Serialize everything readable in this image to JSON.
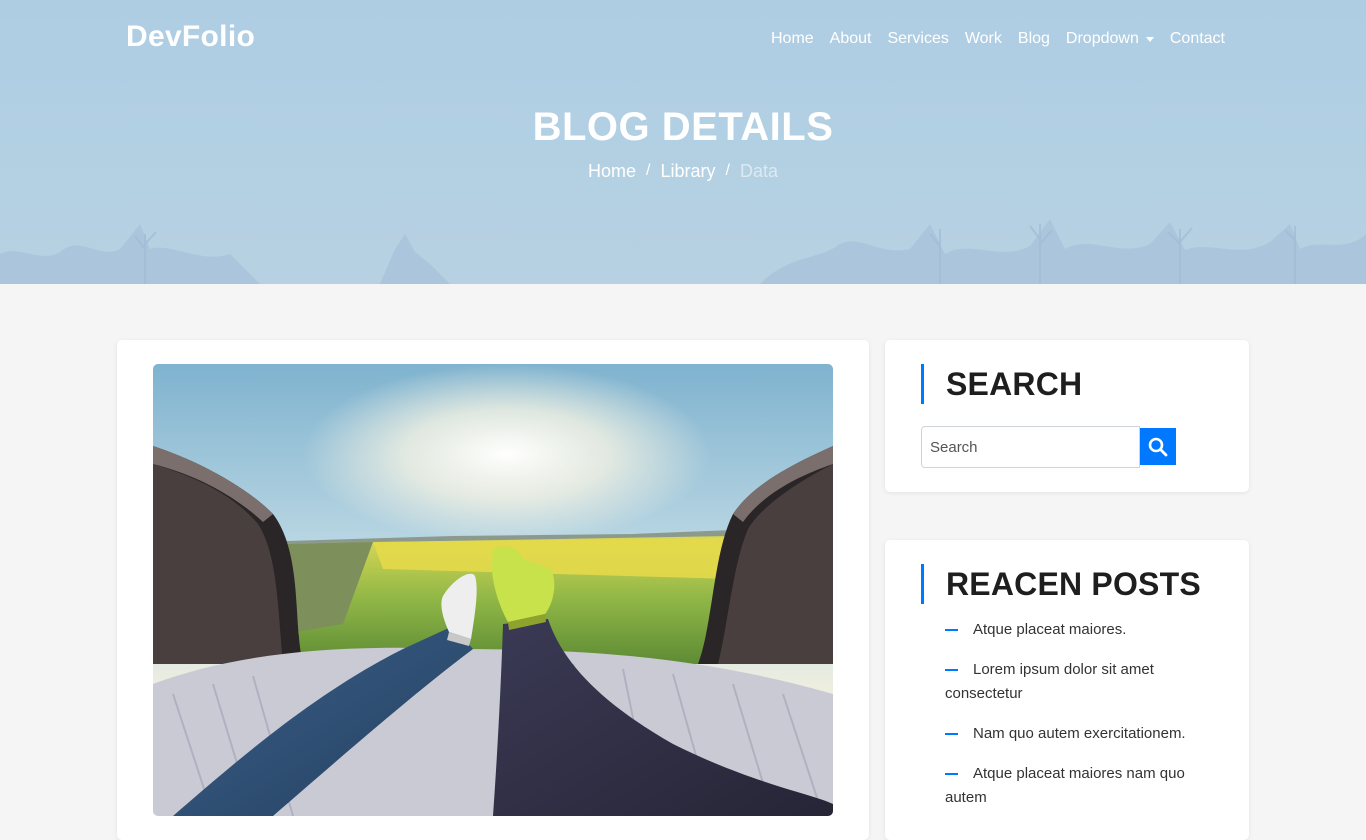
{
  "header": {
    "brand": "DevFolio",
    "nav": [
      "Home",
      "About",
      "Services",
      "Work",
      "Blog",
      "Dropdown",
      "Contact"
    ]
  },
  "hero": {
    "title": "BLOG DETAILS",
    "breadcrumb": [
      "Home",
      "Library",
      "Data"
    ],
    "separator": "/"
  },
  "sidebar": {
    "search": {
      "title": "SEARCH",
      "placeholder": "Search",
      "icon": "search-icon"
    },
    "recent": {
      "title": "REACEN POSTS",
      "posts": [
        "Atque placeat maiores.",
        "Lorem ipsum dolor sit amet consectetur",
        "Nam quo autem exercitationem.",
        "Atque placeat maiores nam quo autem"
      ]
    }
  },
  "colors": {
    "accent": "#0078ff",
    "hero_sky": "#b3d0e3",
    "page_bg": "#f5f5f5"
  }
}
